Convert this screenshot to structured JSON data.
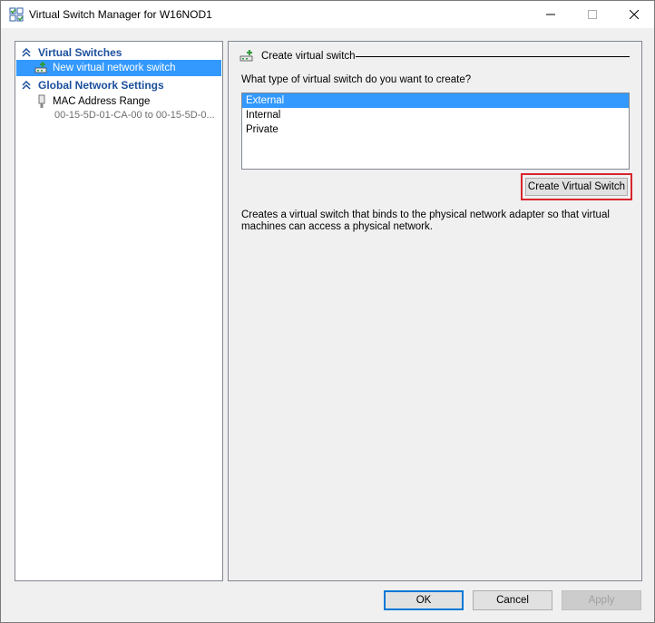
{
  "window": {
    "title": "Virtual Switch Manager for W16NOD1"
  },
  "tree": {
    "virtual_switches_header": "Virtual Switches",
    "new_switch_item": "New virtual network switch",
    "global_settings_header": "Global Network Settings",
    "mac_range_item": "MAC Address Range",
    "mac_range_value": "00-15-5D-01-CA-00 to 00-15-5D-0..."
  },
  "content": {
    "section_title": "Create virtual switch",
    "question": "What type of virtual switch do you want to create?",
    "options": [
      "External",
      "Internal",
      "Private"
    ],
    "selected_option": "External",
    "create_button": "Create Virtual Switch",
    "description": "Creates a virtual switch that binds to the physical network adapter so that virtual machines can access a physical network."
  },
  "buttons": {
    "ok": "OK",
    "cancel": "Cancel",
    "apply": "Apply"
  },
  "colors": {
    "selection": "#3399ff",
    "header_text": "#1b4f9c",
    "highlight_border": "#d9262d"
  }
}
